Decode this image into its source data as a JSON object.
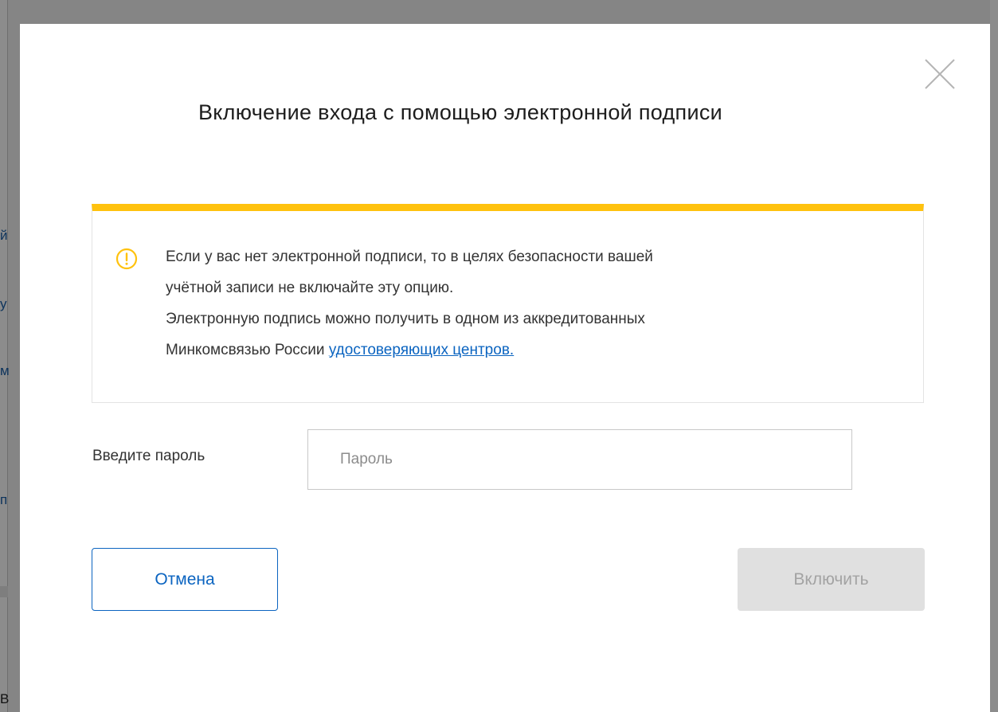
{
  "modal": {
    "title": "Включение входа с помощью электронной подписи",
    "close_icon": "close-icon",
    "warning": {
      "icon": "warning-icon",
      "accent_color": "#ffc20e",
      "line1": "Если у вас нет электронной подписи, то в целях безопасности вашей",
      "line2": "учётной записи не включайте эту опцию.",
      "line3": "Электронную подпись можно получить в одном из аккредитованных",
      "line4_prefix": "Минкомсвязью России ",
      "link_text": "удостоверяющих центров."
    },
    "password": {
      "label": "Введите пароль",
      "placeholder": "Пароль",
      "value": ""
    },
    "buttons": {
      "cancel_label": "Отмена",
      "enable_label": "Включить"
    },
    "colors": {
      "primary": "#0b64c0",
      "disabled_bg": "#e0e0e0",
      "disabled_text": "#a3a3a3"
    }
  },
  "background_fragments": {
    "left": [
      "й",
      "у",
      "м",
      "п",
      "В"
    ]
  }
}
